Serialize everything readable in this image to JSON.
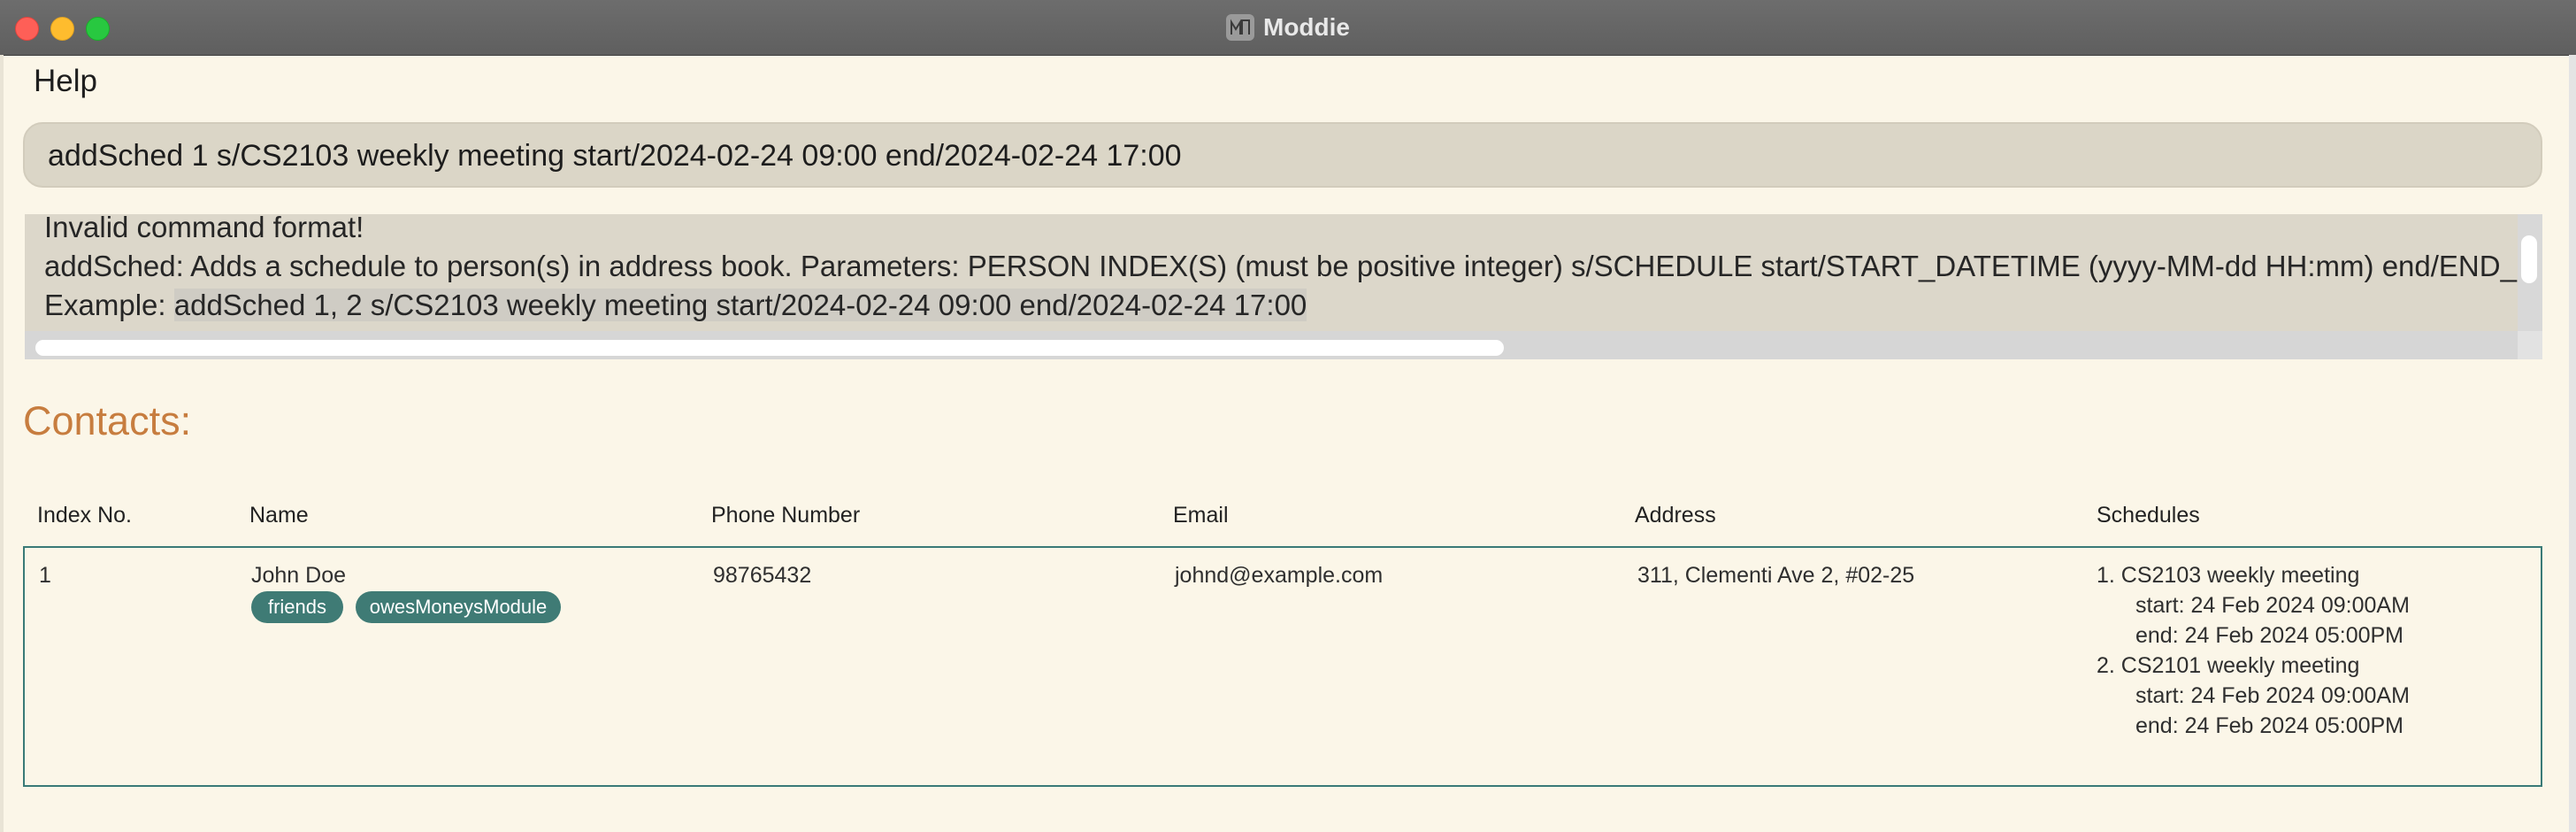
{
  "window": {
    "title": "Moddie"
  },
  "menu": {
    "help": "Help"
  },
  "command": {
    "value": "addSched 1 s/CS2103 weekly meeting start/2024-02-24 09:00 end/2024-02-24 17:00"
  },
  "result": {
    "line1": "Invalid command format!",
    "line2": "addSched: Adds a schedule to person(s) in address book. Parameters: PERSON INDEX(S) (must be positive integer) s/SCHEDULE start/START_DATETIME (yyyy-MM-dd HH:mm) end/END_DAT",
    "line3_prefix": "Example: ",
    "line3_example": "addSched 1, 2 s/CS2103 weekly meeting start/2024-02-24 09:00 end/2024-02-24 17:00"
  },
  "contacts": {
    "title": "Contacts:",
    "headers": {
      "index": "Index No.",
      "name": "Name",
      "phone": "Phone Number",
      "email": "Email",
      "address": "Address",
      "schedules": "Schedules"
    },
    "rows": [
      {
        "index": "1",
        "name": "John Doe",
        "tags": [
          "friends",
          "owesMoneysModule"
        ],
        "phone": "98765432",
        "email": "johnd@example.com",
        "address": "311, Clementi Ave 2, #02-25",
        "schedules": [
          {
            "title": "1. CS2103 weekly meeting",
            "start": "start: 24 Feb 2024 09:00AM",
            "end": "end: 24 Feb 2024 05:00PM"
          },
          {
            "title": "2. CS2101 weekly meeting",
            "start": "start: 24 Feb 2024 09:00AM",
            "end": "end: 24 Feb 2024 05:00PM"
          }
        ]
      }
    ]
  }
}
